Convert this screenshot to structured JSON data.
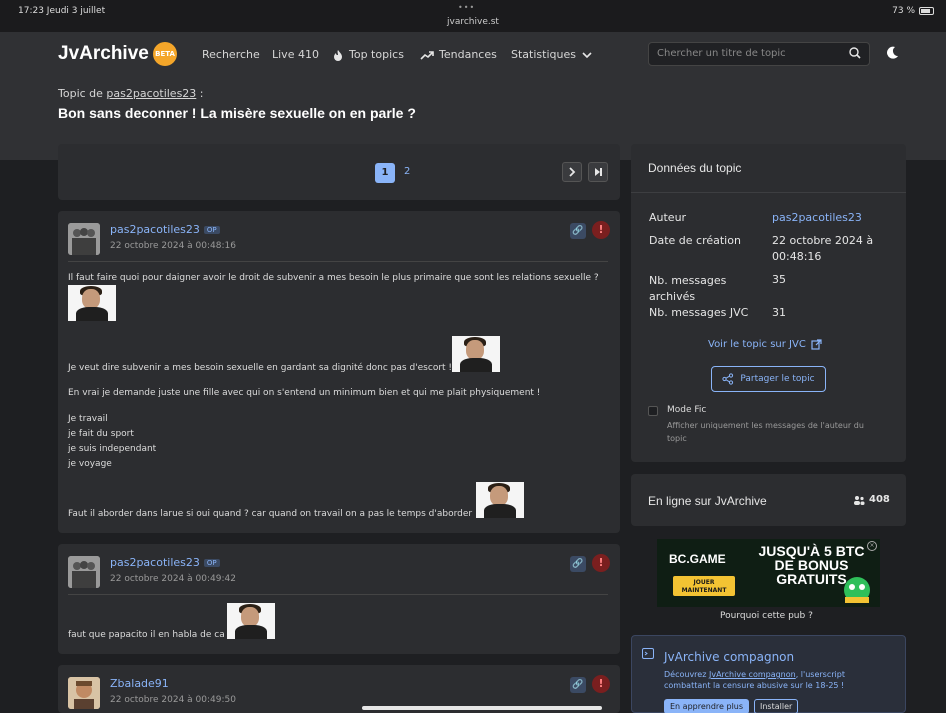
{
  "status_bar": {
    "time": "17:23  Jeudi 3 juillet",
    "dots": "•••",
    "url": "jvarchive.st",
    "battery": "73 %"
  },
  "header": {
    "logo": "JvArchive",
    "logo_badge": "BETA",
    "nav": {
      "search": "Recherche",
      "live": "Live 410",
      "top_topics": "Top topics",
      "trends": "Tendances",
      "stats": "Statistiques"
    },
    "search_placeholder": "Chercher un titre de topic",
    "topic_by_prefix": "Topic de",
    "topic_author": "pas2pacotiles23",
    "topic_by_suffix": " :",
    "topic_title": "Bon sans deconner ! La misère sexuelle on en parle ?"
  },
  "pagination": {
    "current": "1",
    "next": "2"
  },
  "posts": [
    {
      "author": "pas2pacotiles23",
      "badge": "OP",
      "date": "22 octobre 2024 à 00:48:16",
      "lines": [
        "Il faut faire quoi pour daigner avoir le droit de subvenir a mes besoin le plus primaire que sont les relations sexuelle ?",
        "Je veut dire subvenir a mes besoin sexuelle en gardant sa dignité donc pas d'escort !",
        "En vrai je demande juste une fille avec qui on s'entend un minimum bien et qui me plait physiquement !",
        "Je travail",
        "je fait du sport",
        "je suis independant",
        "je voyage",
        "Faut il aborder dans larue si oui quand ? car quand on travail on a pas le temps d'aborder"
      ]
    },
    {
      "author": "pas2pacotiles23",
      "badge": "OP",
      "date": "22 octobre 2024 à 00:49:42",
      "lines": [
        "faut que papacito il en habla de ca"
      ]
    },
    {
      "author": "Zbalade91",
      "date": "22 octobre 2024 à 00:49:50"
    }
  ],
  "sidebar": {
    "topic_data": {
      "title": "Données du topic",
      "author_label": "Auteur",
      "author_value": "pas2pacotiles23",
      "created_label": "Date de création",
      "created_value_1": "22 octobre 2024 à",
      "created_value_2": "00:48:16",
      "archived_label_1": "Nb. messages",
      "archived_label_2": "archivés",
      "archived_value": "35",
      "jvc_label": "Nb. messages JVC",
      "jvc_value": "31",
      "view_on_jvc": "Voir le topic sur JVC",
      "share": "Partager le topic",
      "fic_mode": "Mode Fic",
      "fic_desc_1": "Afficher uniquement les messages de l'auteur du",
      "fic_desc_2": "topic"
    },
    "online": {
      "title": "En ligne sur JvArchive",
      "count": "408"
    },
    "ad": {
      "brand": "BC.GAME",
      "headline": "JUSQU'À 5 BTC DE BONUS GRATUITS",
      "cta": "JOUER MAINTENANT",
      "why": "Pourquoi cette pub ?"
    },
    "companion": {
      "title": "JvArchive compagnon",
      "desc_prefix": "Découvrez ",
      "desc_link": "JvArchive compagnon",
      "desc_suffix": ", l'userscript",
      "desc_2": "combattant la censure abusive sur le 18-25 !",
      "learn_more": "En apprendre plus",
      "install": "Installer"
    }
  },
  "colors": {
    "background": "#1e1f22",
    "header": "#303134",
    "card": "#2c2d30",
    "accent": "#8ab4f8",
    "danger": "#7a1f1f"
  }
}
